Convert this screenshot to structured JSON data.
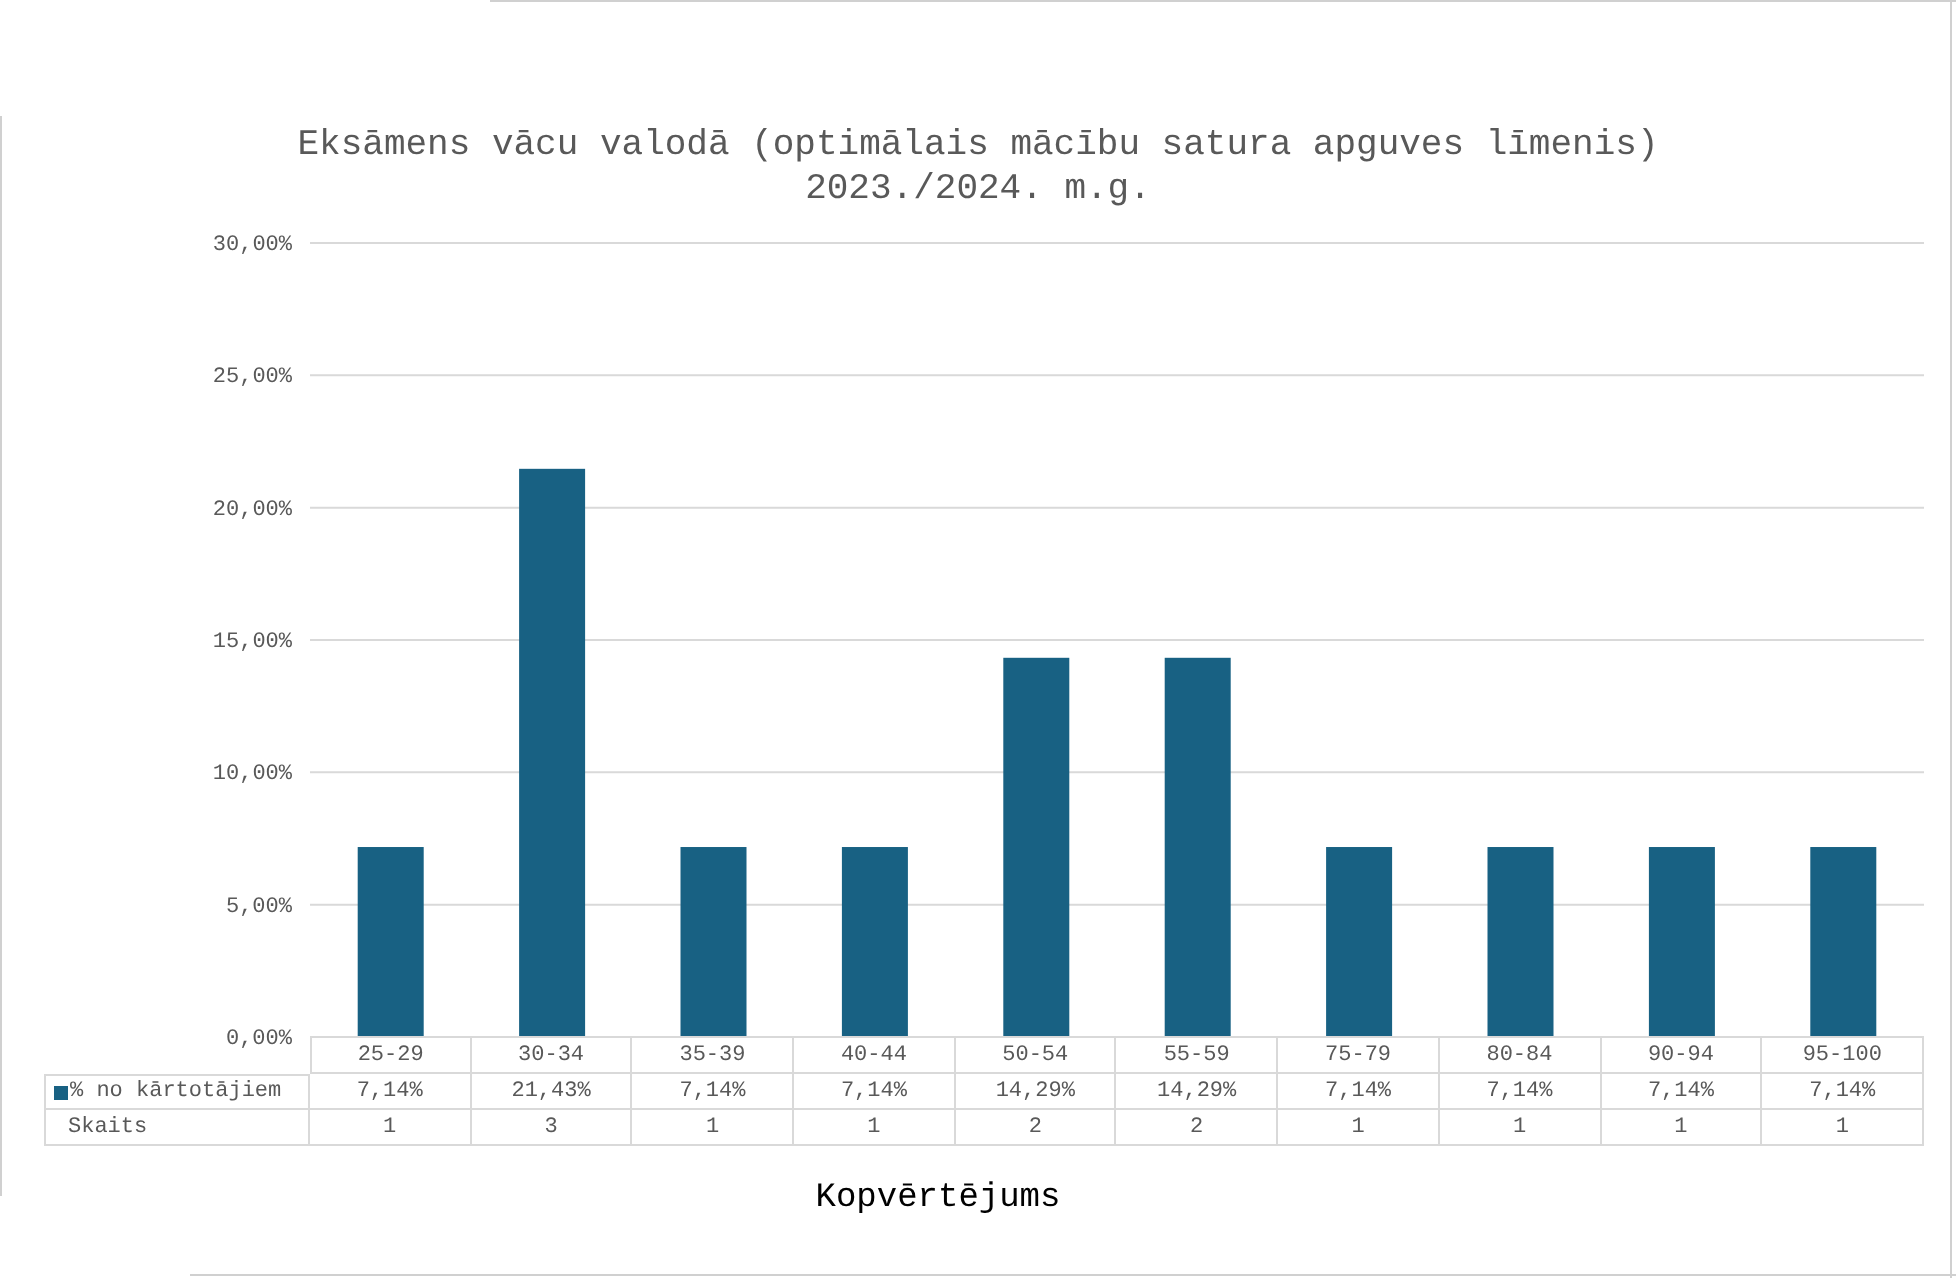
{
  "chart": {
    "subtitle": "2023./2024. m.g.",
    "chart_data": {
      "type": "bar",
      "title": "Eksāmens vācu valodā (optimālais mācību satura apguves līmenis)",
      "xlabel": "Kopvērtējums",
      "categories": [
        "25-29",
        "30-34",
        "35-39",
        "40-44",
        "50-54",
        "55-59",
        "75-79",
        "80-84",
        "90-94",
        "95-100"
      ],
      "series": [
        {
          "name": "% no kārtotājiem",
          "color": "#186183",
          "values": [
            7.14,
            21.43,
            7.14,
            7.14,
            14.29,
            14.29,
            7.14,
            7.14,
            7.14,
            7.14
          ]
        }
      ],
      "ylim": [
        0,
        30
      ],
      "grid": true,
      "yticks": [
        {
          "value": 0,
          "label": "0,00%"
        },
        {
          "value": 5,
          "label": "5,00%"
        },
        {
          "value": 10,
          "label": "10,00%"
        },
        {
          "value": 15,
          "label": "15,00%"
        },
        {
          "value": 20,
          "label": "20,00%"
        },
        {
          "value": 25,
          "label": "25,00%"
        },
        {
          "value": 30,
          "label": "30,00%"
        }
      ]
    },
    "data_table": {
      "rows": [
        {
          "kind": "series",
          "cells": [
            "7,14%",
            "21,43%",
            "7,14%",
            "7,14%",
            "14,29%",
            "14,29%",
            "7,14%",
            "7,14%",
            "7,14%",
            "7,14%"
          ]
        },
        {
          "kind": "plain",
          "label": "Skaits",
          "cells": [
            "1",
            "3",
            "1",
            "1",
            "2",
            "2",
            "1",
            "1",
            "1",
            "1"
          ]
        }
      ]
    }
  }
}
